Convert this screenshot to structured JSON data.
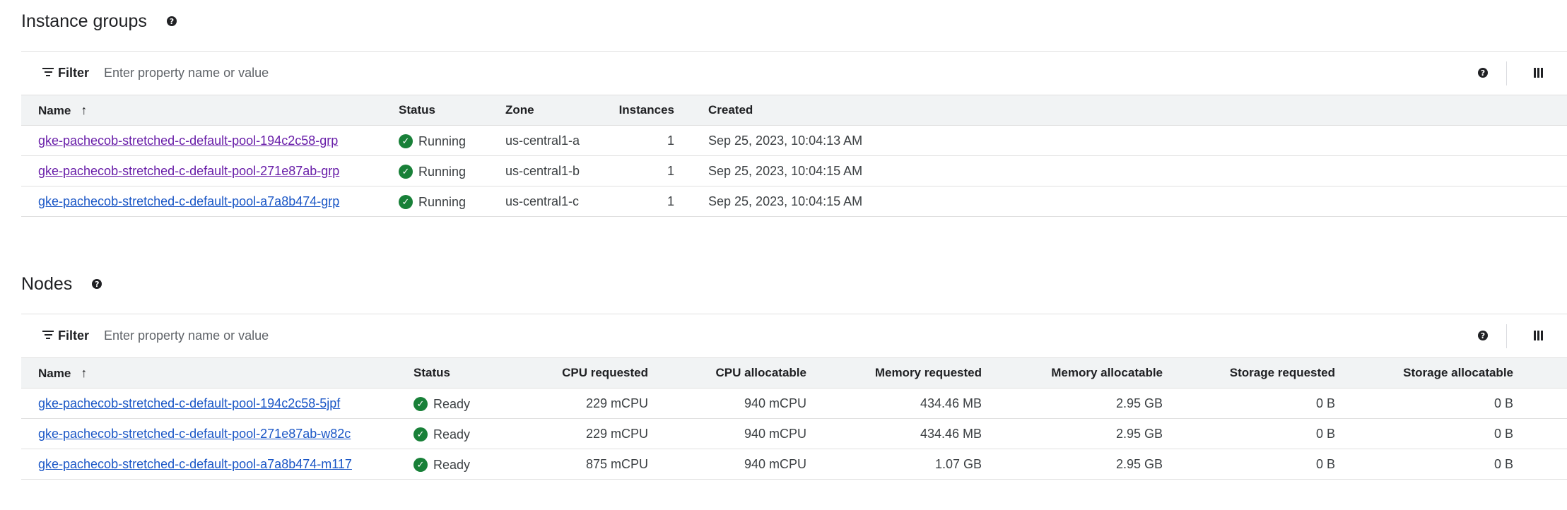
{
  "instance_groups": {
    "title": "Instance groups",
    "help_icon": "help-icon",
    "filter": {
      "label": "Filter",
      "placeholder": "Enter property name or value"
    },
    "columns": [
      "Name",
      "Status",
      "Zone",
      "Instances",
      "Created"
    ],
    "sort_icon": "arrow-up",
    "rows": [
      {
        "name": "gke-pachecob-stretched-c-default-pool-194c2c58-grp",
        "status": "Running",
        "zone": "us-central1-a",
        "instances": "1",
        "created": "Sep 25, 2023, 10:04:13 AM"
      },
      {
        "name": "gke-pachecob-stretched-c-default-pool-271e87ab-grp",
        "status": "Running",
        "zone": "us-central1-b",
        "instances": "1",
        "created": "Sep 25, 2023, 10:04:15 AM"
      },
      {
        "name": "gke-pachecob-stretched-c-default-pool-a7a8b474-grp",
        "status": "Running",
        "zone": "us-central1-c",
        "instances": "1",
        "created": "Sep 25, 2023, 10:04:15 AM"
      }
    ]
  },
  "nodes": {
    "title": "Nodes",
    "help_icon": "help-icon",
    "filter": {
      "label": "Filter",
      "placeholder": "Enter property name or value"
    },
    "columns": [
      "Name",
      "Status",
      "CPU requested",
      "CPU allocatable",
      "Memory requested",
      "Memory allocatable",
      "Storage requested",
      "Storage allocatable"
    ],
    "sort_icon": "arrow-up",
    "rows": [
      {
        "name": "gke-pachecob-stretched-c-default-pool-194c2c58-5jpf",
        "status": "Ready",
        "cpu_requested": "229 mCPU",
        "cpu_allocatable": "940 mCPU",
        "memory_requested": "434.46 MB",
        "memory_allocatable": "2.95 GB",
        "storage_requested": "0 B",
        "storage_allocatable": "0 B"
      },
      {
        "name": "gke-pachecob-stretched-c-default-pool-271e87ab-w82c",
        "status": "Ready",
        "cpu_requested": "229 mCPU",
        "cpu_allocatable": "940 mCPU",
        "memory_requested": "434.46 MB",
        "memory_allocatable": "2.95 GB",
        "storage_requested": "0 B",
        "storage_allocatable": "0 B"
      },
      {
        "name": "gke-pachecob-stretched-c-default-pool-a7a8b474-m117",
        "status": "Ready",
        "cpu_requested": "875 mCPU",
        "cpu_allocatable": "940 mCPU",
        "memory_requested": "1.07 GB",
        "memory_allocatable": "2.95 GB",
        "storage_requested": "0 B",
        "storage_allocatable": "0 B"
      }
    ]
  },
  "colors": {
    "link_visited": "#681da8",
    "link": "#1a56c6",
    "status_ok": "#188038",
    "header_bg": "#f1f3f4"
  }
}
